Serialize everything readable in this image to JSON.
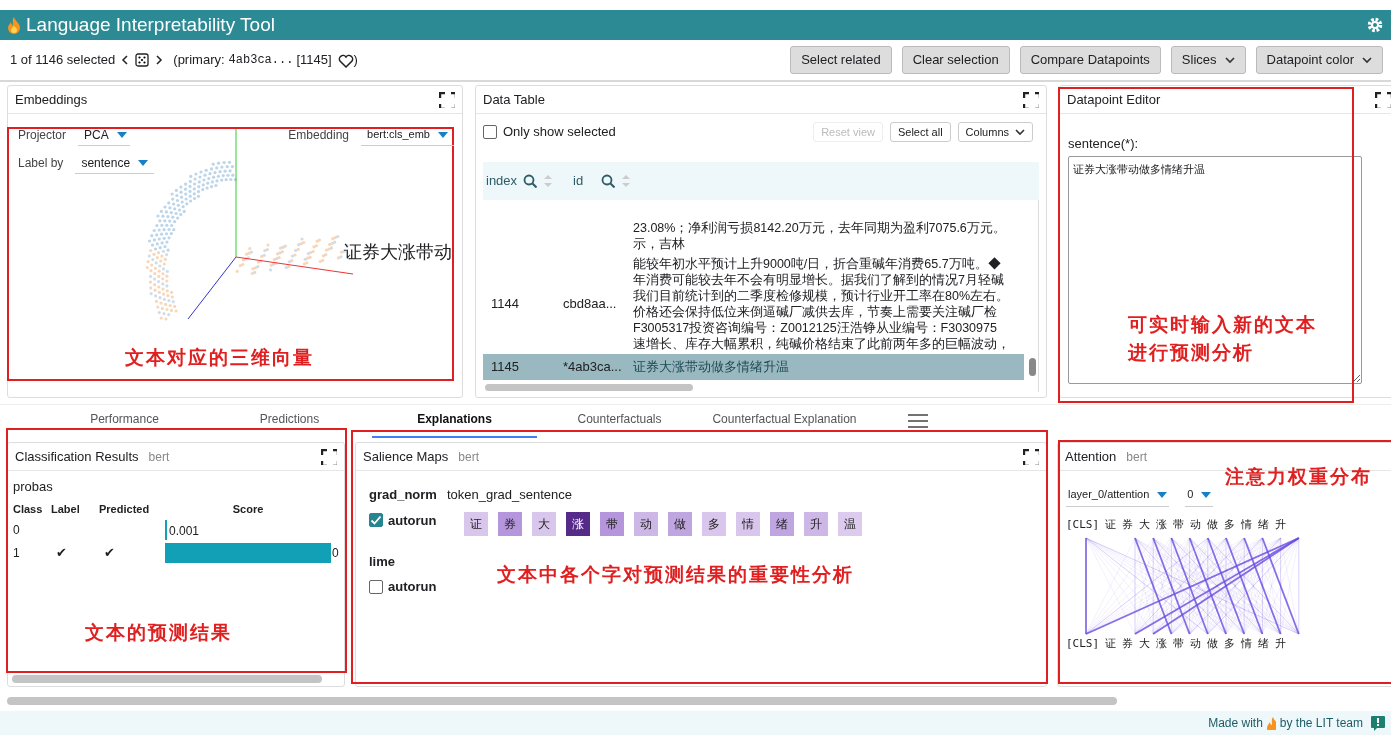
{
  "app": {
    "title": "Language Interpretability Tool"
  },
  "toolbar": {
    "selection": "1 of 1146 selected",
    "primary_label": "(primary:",
    "primary_id": "4ab3ca...",
    "primary_index": "[1145]",
    "close": ")",
    "buttons": [
      {
        "label": "Select related",
        "kind": "button"
      },
      {
        "label": "Clear selection",
        "kind": "button"
      },
      {
        "label": "Compare Datapoints",
        "kind": "button"
      },
      {
        "label": "Slices",
        "kind": "menu"
      },
      {
        "label": "Datapoint color",
        "kind": "menu"
      }
    ]
  },
  "embeddings": {
    "title": "Embeddings",
    "projector": {
      "label": "Projector",
      "value": "PCA"
    },
    "embedding": {
      "label": "Embedding",
      "value": "bert:cls_emb"
    },
    "label_by": {
      "label": "Label by",
      "value": "sentence"
    },
    "point_label": "证券大涨带动"
  },
  "data_table": {
    "title": "Data Table",
    "only_selected": {
      "label": "Only show selected",
      "checked": false
    },
    "buttons": [
      {
        "label": "Reset view",
        "kind": "button",
        "disabled": true
      },
      {
        "label": "Select all",
        "kind": "button",
        "disabled": false
      },
      {
        "label": "Columns",
        "kind": "menu",
        "disabled": false
      }
    ],
    "columns": [
      "index",
      "id"
    ],
    "rows": [
      {
        "selected": false,
        "lines": [
          "23.08%；净利润亏损8142.20万元，去年同期为盈利7075.6万元。",
          "示，吉林"
        ]
      },
      {
        "index": "1144",
        "id": "cbd8aa...",
        "selected": false,
        "lines": [
          "能较年初水平预计上升9000吨/日，折合重碱年消费65.7万吨。◆",
          "年消费可能较去年不会有明显增长。据我们了解到的情况7月轻碱",
          "我们目前统计到的二季度检修规模，预计行业开工率在80%左右。",
          "价格还会保持低位来倒逼碱厂减供去库，节奏上需要关注碱厂检",
          "F3005317投资咨询编号：Z0012125汪浩铮从业编号：F3030975",
          "速增长、库存大幅累积，纯碱价格结束了此前两年多的巨幅波动，"
        ]
      },
      {
        "index": "1145",
        "id": "*4ab3ca...",
        "selected": true,
        "lines": [
          "证券大涨带动做多情绪升温"
        ]
      }
    ]
  },
  "datapoint_editor": {
    "title": "Datapoint Editor",
    "field_label": "sentence(*):",
    "value": "证券大涨带动做多情绪升温"
  },
  "tabs": [
    {
      "label": "Performance",
      "selected": false
    },
    {
      "label": "Predictions",
      "selected": false
    },
    {
      "label": "Explanations",
      "selected": true
    },
    {
      "label": "Counterfactuals",
      "selected": false
    },
    {
      "label": "Counterfactual Explanation",
      "selected": false
    }
  ],
  "classification": {
    "title": "Classification Results",
    "model": "bert",
    "field": "probas",
    "columns": [
      "Class",
      "Label",
      "Predicted",
      "Score"
    ],
    "rows": [
      {
        "class": "0",
        "label": false,
        "predicted": false,
        "score": "0.001"
      },
      {
        "class": "1",
        "label": true,
        "predicted": true,
        "score": "0"
      }
    ],
    "check": "✔"
  },
  "salience": {
    "title": "Salience Maps",
    "model": "bert",
    "methods": [
      {
        "name": "grad_norm",
        "field": "token_grad_sentence",
        "autorun_label": "autorun",
        "autorun": true,
        "tokens": [
          {
            "text": "证",
            "color": "#d9c6ec"
          },
          {
            "text": "券",
            "color": "#b596dc"
          },
          {
            "text": "大",
            "color": "#d9c6ec"
          },
          {
            "text": "涨",
            "color": "#552a88"
          },
          {
            "text": "带",
            "color": "#b596dc"
          },
          {
            "text": "动",
            "color": "#cdb7e6"
          },
          {
            "text": "做",
            "color": "#c0a6e0"
          },
          {
            "text": "多",
            "color": "#d9c6ec"
          },
          {
            "text": "情",
            "color": "#d9c6ec"
          },
          {
            "text": "绪",
            "color": "#c0a6e0"
          },
          {
            "text": "升",
            "color": "#cdb7e6"
          },
          {
            "text": "温",
            "color": "#dccbee"
          }
        ]
      },
      {
        "name": "lime",
        "autorun_label": "autorun",
        "autorun": false
      }
    ]
  },
  "attention": {
    "title": "Attention",
    "model": "bert",
    "layer": "layer_0/attention",
    "head": "0",
    "tokens_top": [
      "[CLS]",
      "证",
      "券",
      "大",
      "涨",
      "带",
      "动",
      "做",
      "多",
      "情",
      "绪",
      "升"
    ],
    "tokens_bottom": [
      "[CLS]",
      "证",
      "券",
      "大",
      "涨",
      "带",
      "动",
      "做",
      "多",
      "情",
      "绪",
      "升"
    ]
  },
  "footer": {
    "before": "Made with",
    "after": "by the LIT team"
  },
  "annotations": [
    {
      "text": "文本对应的三维向量"
    },
    {
      "text": "可实时输入新的文本进行预测分析"
    },
    {
      "text": "文本的预测结果"
    },
    {
      "text": "文本中各个字对预测结果的重要性分析"
    },
    {
      "text": "注意力权重分布"
    }
  ]
}
